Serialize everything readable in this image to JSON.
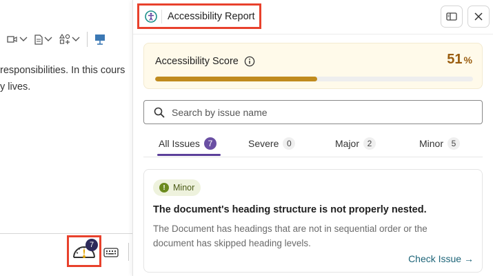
{
  "editor": {
    "text_lines": [
      "responsibilities. In this cours",
      "y lives."
    ],
    "gauge_badge": "7"
  },
  "panel": {
    "title": "Accessibility Report",
    "score": {
      "label": "Accessibility Score",
      "value": "51",
      "unit": "%",
      "percent": 51,
      "fill_color": "#c08b1e"
    },
    "search": {
      "placeholder": "Search by issue name"
    },
    "tabs": [
      {
        "label": "All Issues",
        "count": "7",
        "active": true
      },
      {
        "label": "Severe",
        "count": "0",
        "active": false
      },
      {
        "label": "Major",
        "count": "2",
        "active": false
      },
      {
        "label": "Minor",
        "count": "5",
        "active": false
      }
    ],
    "issue": {
      "severity": "Minor",
      "title": "The document's heading structure is not properly nested.",
      "description": "The Document has headings that are not in sequential order or the document has skipped heading levels.",
      "action": "Check Issue →"
    }
  },
  "colors": {
    "accent": "#5b3f9a",
    "highlight": "#e8412c",
    "score_text": "#9a5d10",
    "link": "#1d6478"
  }
}
